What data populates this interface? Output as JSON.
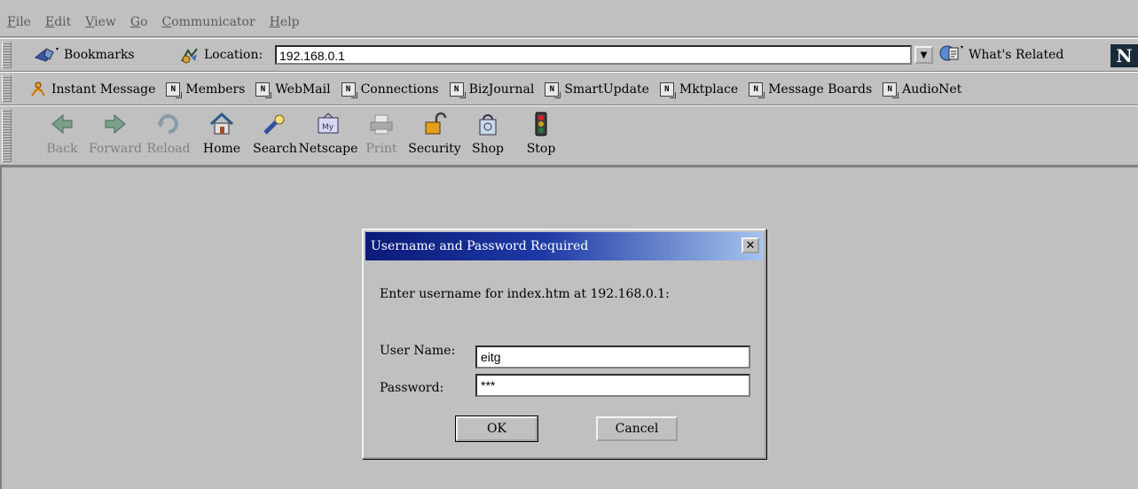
{
  "menu": [
    {
      "label": "File"
    },
    {
      "label": "Edit"
    },
    {
      "label": "View"
    },
    {
      "label": "Go"
    },
    {
      "label": "Communicator"
    },
    {
      "label": "Help"
    }
  ],
  "location_bar": {
    "bookmarks_label": "Bookmarks",
    "location_label": "Location:",
    "url": "192.168.0.1",
    "whats_related_label": "What's Related",
    "logo_letter": "N"
  },
  "personal_toolbar": {
    "items": [
      {
        "label": "Instant Message"
      },
      {
        "label": "Members"
      },
      {
        "label": "WebMail"
      },
      {
        "label": "Connections"
      },
      {
        "label": "BizJournal"
      },
      {
        "label": "SmartUpdate"
      },
      {
        "label": "Mktplace"
      },
      {
        "label": "Message Boards"
      },
      {
        "label": "AudioNet"
      }
    ],
    "bookmark_icon_letter": "N"
  },
  "nav_toolbar": {
    "buttons": [
      {
        "label": "Back",
        "icon": "back-arrow-icon",
        "enabled": false
      },
      {
        "label": "Forward",
        "icon": "forward-arrow-icon",
        "enabled": false
      },
      {
        "label": "Reload",
        "icon": "reload-icon",
        "enabled": false
      },
      {
        "label": "Home",
        "icon": "home-icon",
        "enabled": true
      },
      {
        "label": "Search",
        "icon": "search-icon",
        "enabled": true
      },
      {
        "label": "Netscape",
        "icon": "my-netscape-icon",
        "enabled": true
      },
      {
        "label": "Print",
        "icon": "print-icon",
        "enabled": false
      },
      {
        "label": "Security",
        "icon": "lock-icon",
        "enabled": true
      },
      {
        "label": "Shop",
        "icon": "shopping-bag-icon",
        "enabled": true
      },
      {
        "label": "Stop",
        "icon": "stop-light-icon",
        "enabled": true
      }
    ]
  },
  "dialog": {
    "title": "Username and Password Required",
    "close_glyph": "✕",
    "prompt": "Enter username for index.htm at 192.168.0.1:",
    "username_label": "User Name:",
    "username_value": "eitg",
    "password_label": "Password:",
    "password_value": "***",
    "ok_label": "OK",
    "cancel_label": "Cancel"
  },
  "colors": {
    "chrome": "#c0c0c0",
    "title_start": "#0a1a78",
    "title_end": "#a6c4ee"
  }
}
